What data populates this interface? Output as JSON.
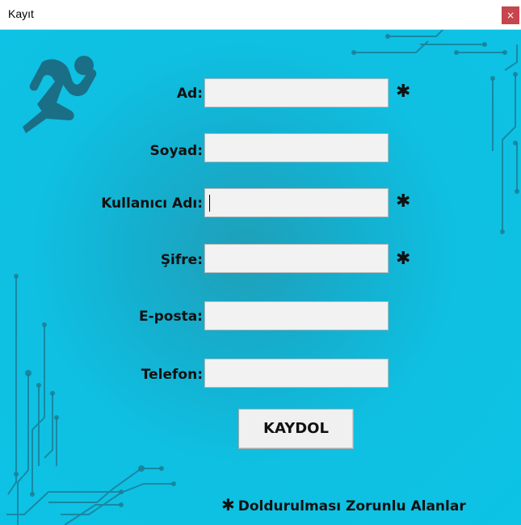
{
  "window": {
    "title": "Kayıt",
    "close_label": "×"
  },
  "form": {
    "fields": [
      {
        "label": "Ad:",
        "value": "",
        "required": true
      },
      {
        "label": "Soyad:",
        "value": "",
        "required": false
      },
      {
        "label": "Kullanıcı Adı:",
        "value": "",
        "required": true
      },
      {
        "label": "Şifre:",
        "value": "",
        "required": true
      },
      {
        "label": "E-posta:",
        "value": "",
        "required": false
      },
      {
        "label": "Telefon:",
        "value": "",
        "required": false
      }
    ],
    "required_marker": "✱",
    "submit_label": "KAYDOL",
    "required_note": "Doldurulması Zorunlu Alanlar"
  },
  "icons": {
    "logo": "runner-logo-icon",
    "close": "close-icon"
  },
  "colors": {
    "background": "#0cc3e5",
    "background_center": "#1f9fb8",
    "circuit": "#1a7f98",
    "close_button": "#c5464c",
    "input_background": "#f2f2f2"
  }
}
